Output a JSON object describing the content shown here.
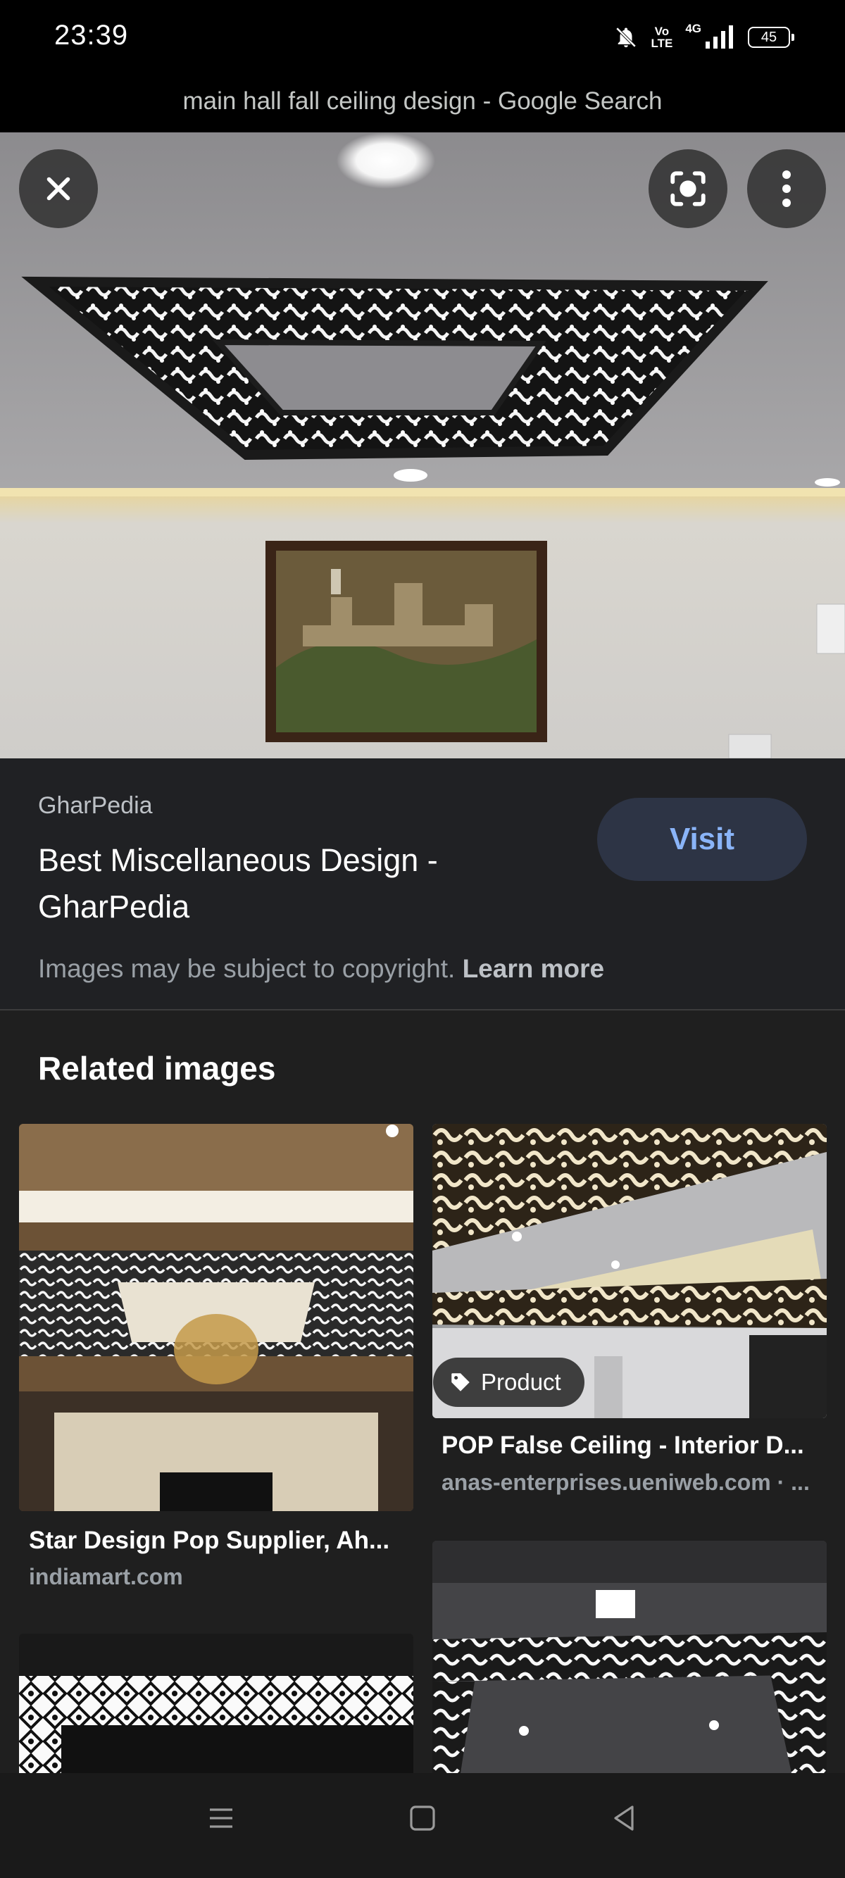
{
  "status_bar": {
    "time": "23:39",
    "volte": "Vo\nLTE",
    "network": "4G",
    "battery": "45"
  },
  "title_bar": {
    "title": "main hall fall ceiling design - Google Search"
  },
  "hero_actions": {
    "close_icon": "close-icon",
    "lens_icon": "google-lens-icon",
    "more_icon": "more-vert-icon"
  },
  "result": {
    "source": "GharPedia",
    "title": "Best Miscellaneous Design - GharPedia",
    "visit_label": "Visit",
    "copyright_text": "Images may be subject to copyright.",
    "learn_more": "Learn more"
  },
  "related": {
    "heading": "Related images",
    "items": [
      {
        "title": "Star Design Pop Supplier, Ah...",
        "domain": "indiamart.com"
      },
      {
        "title": "POP False Ceiling - Interior D...",
        "domain": "anas-enterprises.ueniweb.com · ...",
        "chip": "Product"
      }
    ]
  },
  "colors": {
    "accent": "#8ab4f8",
    "visit_bg": "#2d3445",
    "panel_bg": "#202124"
  }
}
